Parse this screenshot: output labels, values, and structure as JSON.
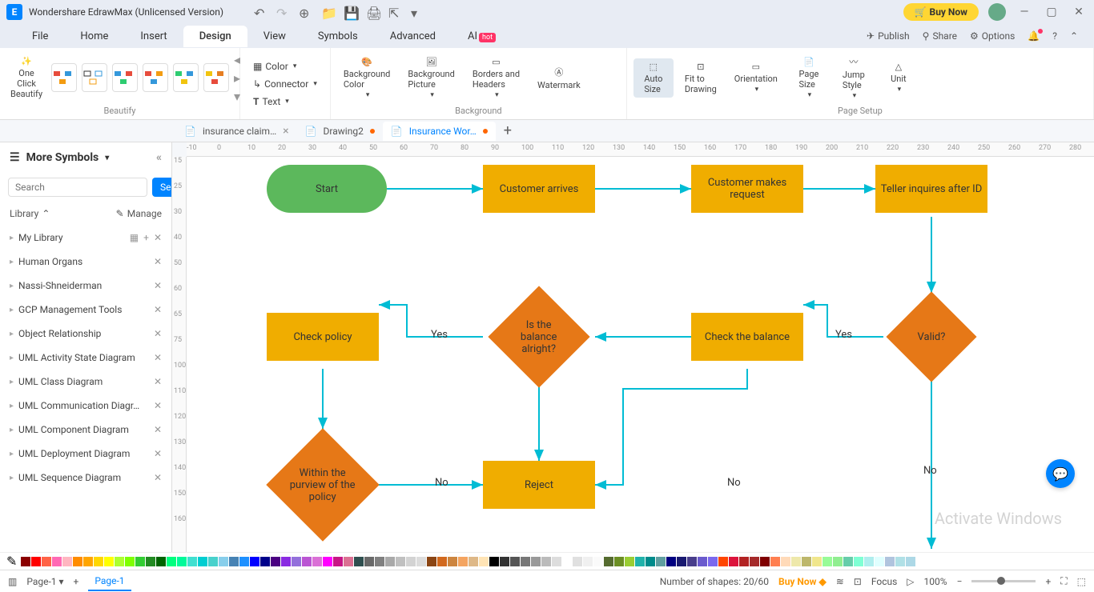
{
  "app_title": "Wondershare EdrawMax (Unlicensed Version)",
  "buy_now": "Buy Now",
  "menu": {
    "items": [
      "File",
      "Home",
      "Insert",
      "Design",
      "View",
      "Symbols",
      "Advanced",
      "AI"
    ],
    "active": "Design",
    "right": {
      "publish": "Publish",
      "share": "Share",
      "options": "Options"
    }
  },
  "ribbon": {
    "beautify": {
      "one_click": "One Click\nBeautify",
      "label": "Beautify"
    },
    "format": {
      "color": "Color",
      "connector": "Connector",
      "text": "Text"
    },
    "background": {
      "bg_color": "Background\nColor",
      "bg_picture": "Background\nPicture",
      "borders": "Borders and\nHeaders",
      "watermark": "Watermark",
      "label": "Background"
    },
    "page_setup": {
      "auto_size": "Auto\nSize",
      "fit": "Fit to\nDrawing",
      "orientation": "Orientation",
      "page_size": "Page\nSize",
      "jump_style": "Jump\nStyle",
      "unit": "Unit",
      "label": "Page Setup"
    }
  },
  "doc_tabs": [
    {
      "name": "insurance claim…",
      "dirty": false,
      "active": false
    },
    {
      "name": "Drawing2",
      "dirty": true,
      "active": false
    },
    {
      "name": "Insurance Wor…",
      "dirty": true,
      "active": true
    }
  ],
  "sidebar": {
    "title": "More Symbols",
    "search_placeholder": "Search",
    "search_btn": "Search",
    "library_label": "Library",
    "manage": "Manage",
    "items": [
      "My Library",
      "Human Organs",
      "Nassi-Shneiderman",
      "GCP Management Tools",
      "Object Relationship",
      "UML Activity State Diagram",
      "UML Class Diagram",
      "UML Communication Diagr…",
      "UML Component Diagram",
      "UML Deployment Diagram",
      "UML Sequence Diagram"
    ]
  },
  "flowchart": {
    "start": "Start",
    "arrives": "Customer arrives",
    "request": "Customer makes request",
    "teller": "Teller inquires after ID",
    "valid": "Valid?",
    "check_balance": "Check the balance",
    "balance_ok": "Is the balance alright?",
    "check_policy": "Check policy",
    "within": "Within the purview of the policy",
    "reject": "Reject",
    "yes1": "Yes",
    "yes2": "Yes",
    "no1": "No",
    "no2": "No",
    "no3": "No"
  },
  "ruler_h": [
    "-10",
    "0",
    "10",
    "20",
    "30",
    "40",
    "50",
    "60",
    "70",
    "80",
    "90",
    "100",
    "110",
    "120",
    "130",
    "140",
    "150",
    "160",
    "170",
    "180",
    "190",
    "200",
    "210",
    "220",
    "230",
    "240",
    "250",
    "260",
    "270",
    "280"
  ],
  "ruler_v": [
    "15",
    "25",
    "30",
    "40",
    "50",
    "60",
    "65",
    "75",
    "100",
    "110",
    "120",
    "130",
    "140",
    "150",
    "160"
  ],
  "colors": [
    "#8b0000",
    "#ff0000",
    "#ff6347",
    "#ff69b4",
    "#ffb6c1",
    "#ff8c00",
    "#ffa500",
    "#ffd700",
    "#ffff00",
    "#adff2f",
    "#7fff00",
    "#32cd32",
    "#228b22",
    "#006400",
    "#00ff7f",
    "#00fa9a",
    "#40e0d0",
    "#00ced1",
    "#48d1cc",
    "#87ceeb",
    "#4682b4",
    "#1e90ff",
    "#0000ff",
    "#00008b",
    "#4b0082",
    "#8a2be2",
    "#9370db",
    "#ba55d3",
    "#da70d6",
    "#ff00ff",
    "#c71585",
    "#db7093",
    "#2f4f4f",
    "#696969",
    "#808080",
    "#a9a9a9",
    "#c0c0c0",
    "#d3d3d3",
    "#dcdcdc",
    "#8b4513",
    "#d2691e",
    "#cd853f",
    "#f4a460",
    "#deb887",
    "#ffe4b5",
    "#000000",
    "#333333",
    "#555555",
    "#777777",
    "#999999",
    "#bbbbbb",
    "#dddddd",
    "#ffffff",
    "#e0e0e0",
    "#f0f0f0",
    "#fafafa",
    "#556b2f",
    "#6b8e23",
    "#9acd32",
    "#20b2aa",
    "#008b8b",
    "#5f9ea0",
    "#000080",
    "#191970",
    "#483d8b",
    "#6a5acd",
    "#7b68ee",
    "#ff4500",
    "#dc143c",
    "#b22222",
    "#a52a2a",
    "#800000",
    "#ff7f50",
    "#ffdab9",
    "#eee8aa",
    "#bdb76b",
    "#f0e68c",
    "#98fb98",
    "#90ee90",
    "#66cdaa",
    "#7fffd4",
    "#afeeee",
    "#e0ffff",
    "#b0c4de",
    "#b0e0e6",
    "#add8e6"
  ],
  "status": {
    "page_tab": "Page-1",
    "page_select": "Page-1",
    "shapes": "Number of shapes: 20/60",
    "buy_now": "Buy Now",
    "focus": "Focus",
    "zoom": "100%"
  },
  "watermark": "Activate Windows"
}
